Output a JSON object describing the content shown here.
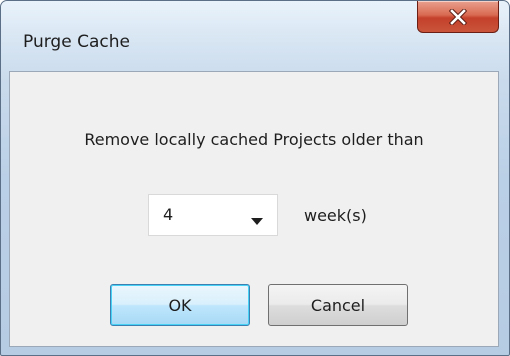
{
  "window": {
    "title": "Purge Cache"
  },
  "icons": {
    "close": "close-icon",
    "dropdown": "chevron-down-icon"
  },
  "dialog": {
    "message": "Remove locally cached Projects older than",
    "age_select": {
      "value": "4"
    },
    "unit_label": "week(s)",
    "ok_label": "OK",
    "cancel_label": "Cancel"
  },
  "colors": {
    "client_background": "#f0f0f0",
    "close_button": "#c4402a",
    "default_button_border": "#3c7fb1"
  }
}
